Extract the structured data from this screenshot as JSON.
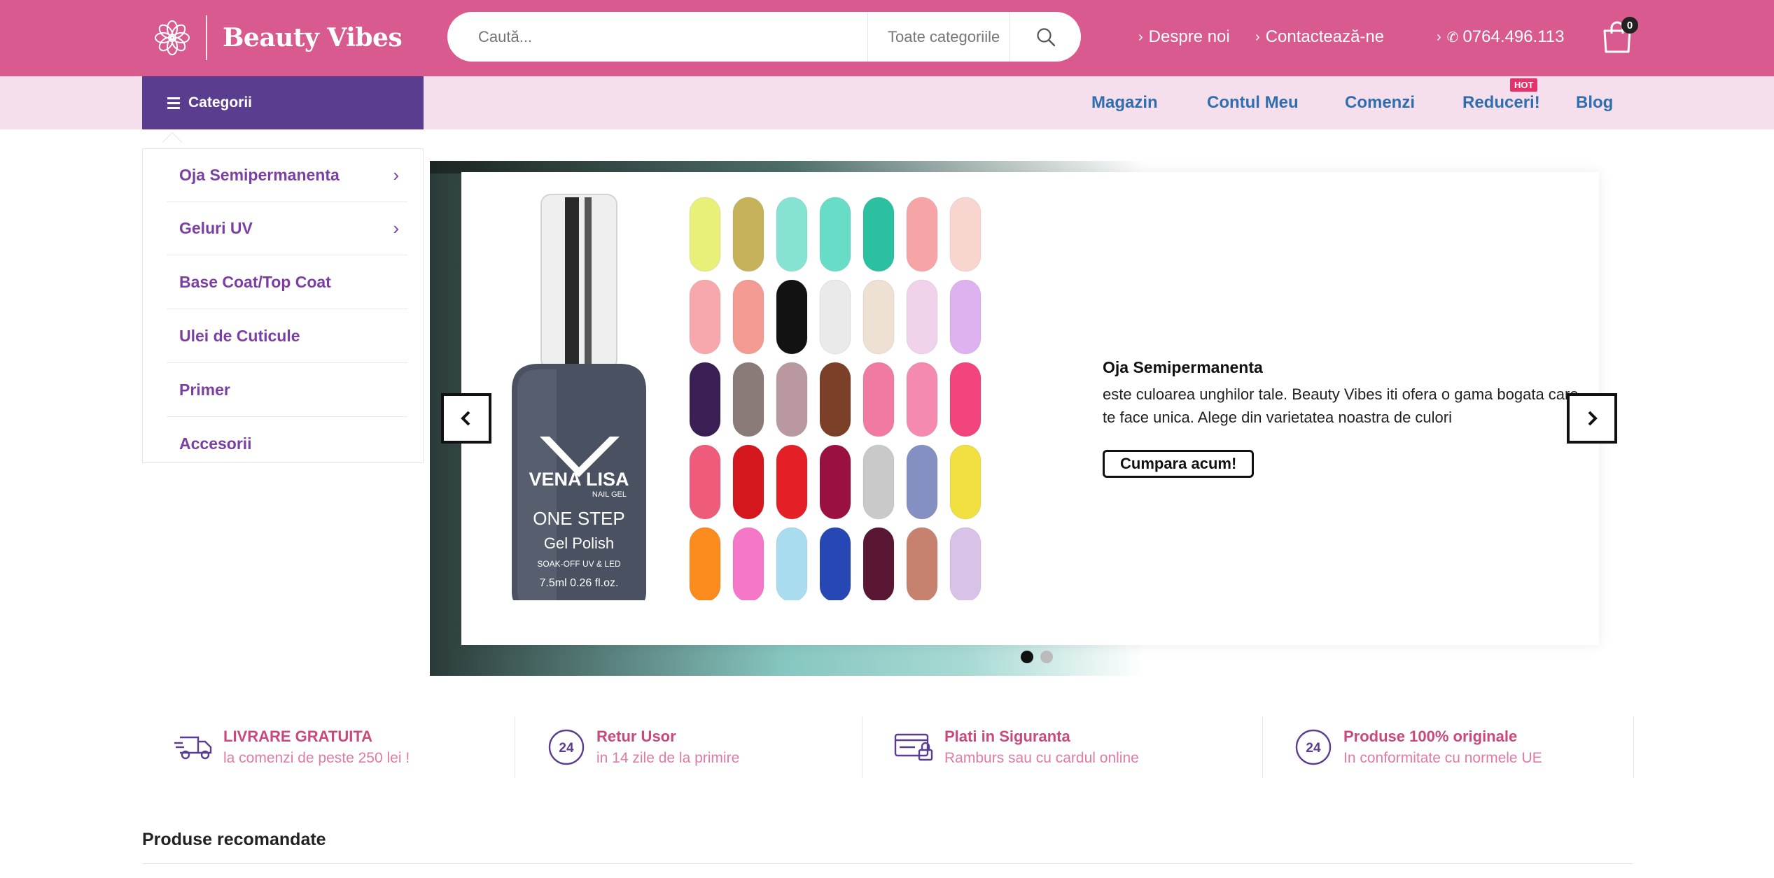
{
  "header": {
    "brand": "Beauty Vibes",
    "search_placeholder": "Caută...",
    "category_select": "Toate categoriile",
    "links": [
      {
        "label": "Despre noi"
      },
      {
        "label": "Contactează-ne"
      },
      {
        "label": "0764.496.113"
      }
    ],
    "cart_count": "0"
  },
  "nav": {
    "categories_label": "Categorii",
    "items": [
      {
        "label": "Magazin"
      },
      {
        "label": "Contul Meu"
      },
      {
        "label": "Comenzi"
      },
      {
        "label": "Reduceri!"
      },
      {
        "label": "Blog"
      }
    ],
    "hot_badge": "HOT"
  },
  "categories": [
    {
      "label": "Oja Semipermanenta",
      "has_children": true
    },
    {
      "label": "Geluri UV",
      "has_children": true
    },
    {
      "label": "Base Coat/Top Coat",
      "has_children": false
    },
    {
      "label": "Ulei de Cuticule",
      "has_children": false
    },
    {
      "label": "Primer",
      "has_children": false
    },
    {
      "label": "Accesorii",
      "has_children": false
    }
  ],
  "hero": {
    "title": "Oja Semipermanenta",
    "description": "este culoarea unghilor tale. Beauty Vibes iti ofera o gama bogata care te face unica. Alege din varietatea noastra de culori",
    "button": "Cumpara acum!",
    "product_brand": "VENA LISA",
    "product_sub": "NAIL GEL",
    "product_line": "ONE STEP",
    "product_type": "Gel Polish",
    "product_note": "SOAK-OFF UV & LED",
    "product_volume": "7.5ml  0.26 fl.oz.",
    "active_slide": 1,
    "slide_count": 2
  },
  "features": [
    {
      "title": "LIVRARE GRATUITA",
      "subtitle": "la comenzi de peste 250 lei !",
      "icon": "truck-icon"
    },
    {
      "title": "Retur Usor",
      "subtitle": "in 14 zile de la primire",
      "icon": "24h-return-icon"
    },
    {
      "title": "Plati in Siguranta",
      "subtitle": "Ramburs sau cu cardul online",
      "icon": "secure-payment-icon"
    },
    {
      "title": "Produse 100% originale",
      "subtitle": "In conformitate cu normele UE",
      "icon": "24h-original-icon"
    }
  ],
  "section": {
    "title": "Produse recomandate"
  },
  "colors": {
    "header_pink": "#d95a8e",
    "nav_pink": "#f6dfec",
    "categories_purple": "#5b3d8f",
    "nav_link_blue": "#2f6fb0",
    "category_text": "#7b3fa3",
    "feature_pink": "#c8497e"
  },
  "swatches": [
    "#e8f07a",
    "#c5b25a",
    "#86e3d2",
    "#67dcc6",
    "#2bc1a0",
    "#f6a4a6",
    "#f8d6cf",
    "#f6a8ad",
    "#f39a92",
    "#121212",
    "#eaeaea",
    "#eee0d2",
    "#f0d2ea",
    "#ddb2ee",
    "#3a1f55",
    "#8a7b79",
    "#b9999f",
    "#7c4028",
    "#f07aa2",
    "#f58ab0",
    "#f2457e",
    "#ef5b7a",
    "#d4171d",
    "#e41f25",
    "#9a1040",
    "#c9c9c9",
    "#8590c2",
    "#f1e03f",
    "#fa8b1c",
    "#f676c8",
    "#a9dcef",
    "#2747b5",
    "#5a1733",
    "#c7826f",
    "#d9c2e8",
    "#ecc5d4"
  ]
}
